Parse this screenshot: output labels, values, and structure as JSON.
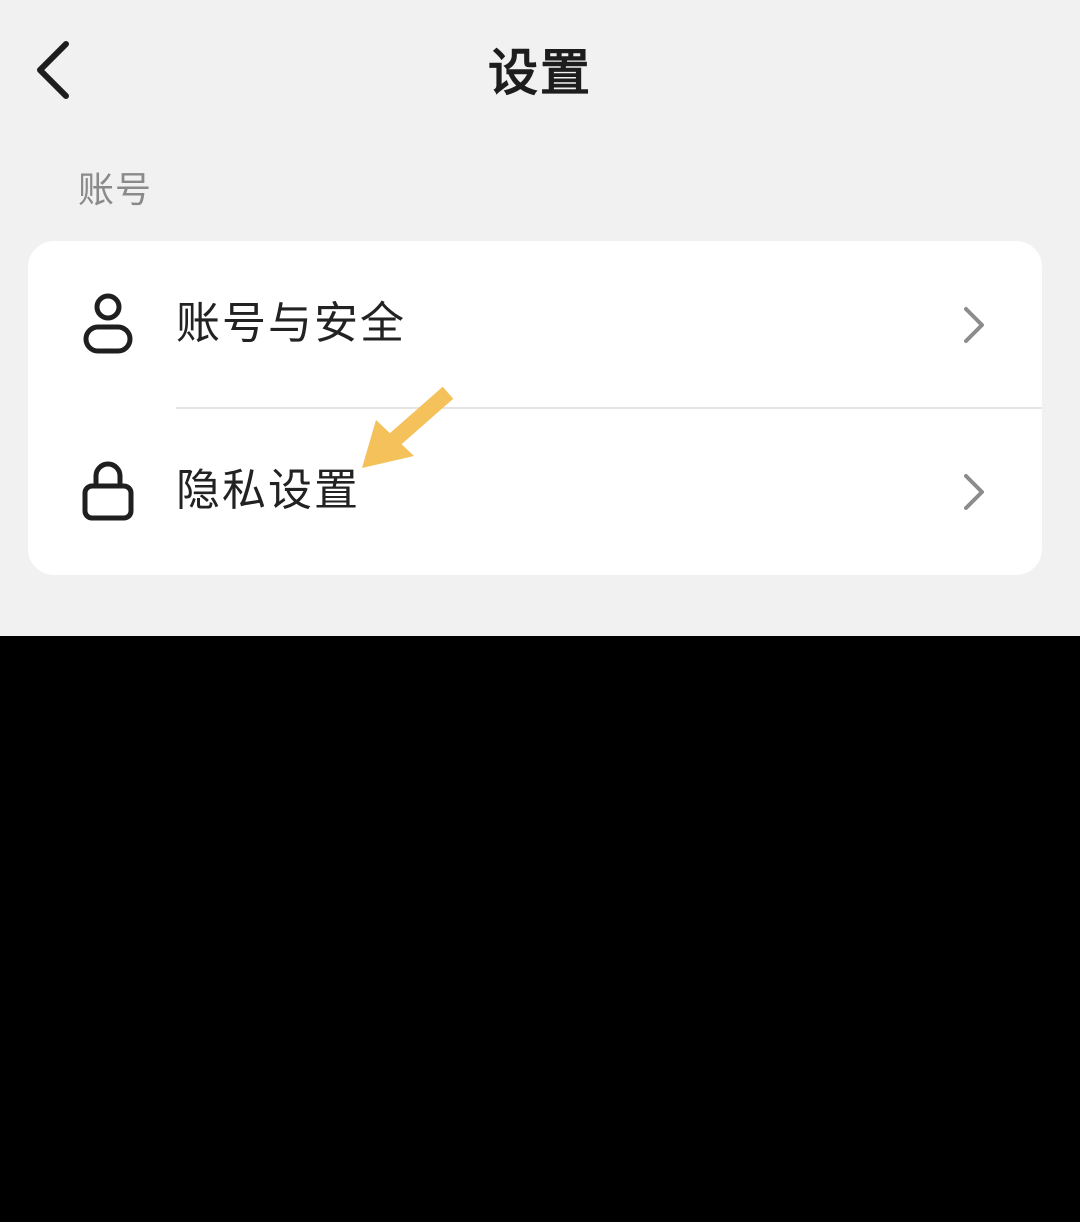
{
  "header": {
    "title": "设置",
    "back_icon": "chevron-left-icon"
  },
  "account_section": {
    "label": "账号",
    "items": [
      {
        "label": "账号与安全",
        "icon": "user-icon"
      },
      {
        "label": "隐私设置",
        "icon": "lock-icon"
      }
    ]
  },
  "colors": {
    "background": "#f1f1f1",
    "card": "#ffffff",
    "annotation_arrow": "#f4c15a",
    "lower_area": "#000000"
  }
}
